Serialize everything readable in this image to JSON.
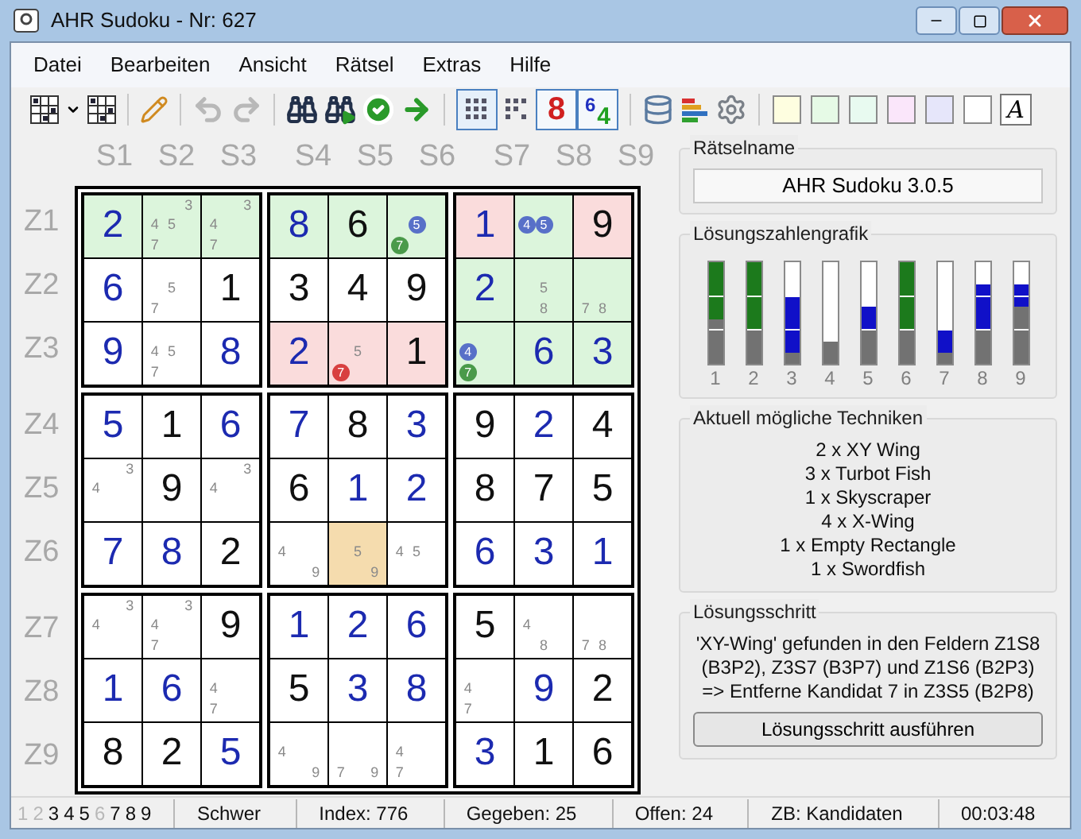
{
  "window": {
    "title": "AHR Sudoku - Nr: 627"
  },
  "menu": [
    "Datei",
    "Bearbeiten",
    "Ansicht",
    "Rätsel",
    "Extras",
    "Hilfe"
  ],
  "toolbar": {
    "undo": {
      "disabled": true
    },
    "redo": {
      "disabled": true
    },
    "all_candidates": {
      "selected": true
    },
    "value_mode": {
      "label": "8",
      "selected": true
    },
    "candidate_mode": {
      "labels": [
        "6",
        "4"
      ],
      "selected": true
    },
    "swatches": [
      {
        "color": "#fefee0"
      },
      {
        "color": "#e6fae6"
      },
      {
        "color": "#e8faf0"
      },
      {
        "color": "#fae6fa"
      },
      {
        "color": "#e6e6fa"
      },
      {
        "color": "#ffffff"
      }
    ],
    "font_button": "A"
  },
  "grid": {
    "columns": [
      "S1",
      "S2",
      "S3",
      "S4",
      "S5",
      "S6",
      "S7",
      "S8",
      "S9"
    ],
    "rows": [
      {
        "label": "Z1",
        "cells": [
          {
            "value": "2",
            "given": false,
            "color": "#dcf5dc"
          },
          {
            "candidates": [
              {
                "digit": "3"
              },
              {
                "digit": "4"
              },
              {
                "digit": "5"
              },
              {
                "digit": "7"
              }
            ],
            "color": "#dcf5dc"
          },
          {
            "candidates": [
              {
                "digit": "3"
              },
              {
                "digit": "4"
              },
              {
                "digit": "7"
              }
            ],
            "color": "#dcf5dc"
          },
          {
            "value": "8",
            "given": false,
            "color": "#dcf5dc"
          },
          {
            "value": "6",
            "given": true,
            "color": "#dcf5dc"
          },
          {
            "candidates": [
              {
                "digit": "5",
                "color": "#5870c8"
              },
              {
                "digit": "7",
                "color": "#4a9a4a"
              }
            ],
            "color": "#dcf5dc"
          },
          {
            "value": "1",
            "given": false,
            "color": "#fadcdc"
          },
          {
            "candidates": [
              {
                "digit": "4",
                "color": "#5870c8"
              },
              {
                "digit": "5",
                "color": "#5870c8"
              }
            ],
            "color": "#dcf5dc"
          },
          {
            "value": "9",
            "given": true,
            "color": "#fadcdc"
          }
        ]
      },
      {
        "label": "Z2",
        "cells": [
          {
            "value": "6",
            "given": false
          },
          {
            "candidates": [
              {
                "digit": "5"
              },
              {
                "digit": "7"
              }
            ]
          },
          {
            "value": "1",
            "given": true
          },
          {
            "value": "3",
            "given": true
          },
          {
            "value": "4",
            "given": true
          },
          {
            "value": "9",
            "given": true
          },
          {
            "value": "2",
            "given": false,
            "color": "#dcf5dc"
          },
          {
            "candidates": [
              {
                "digit": "5"
              },
              {
                "digit": "8"
              }
            ],
            "color": "#dcf5dc"
          },
          {
            "candidates": [
              {
                "digit": "7"
              },
              {
                "digit": "8"
              }
            ],
            "color": "#dcf5dc"
          }
        ]
      },
      {
        "label": "Z3",
        "cells": [
          {
            "value": "9",
            "given": false
          },
          {
            "candidates": [
              {
                "digit": "4"
              },
              {
                "digit": "5"
              },
              {
                "digit": "7"
              }
            ]
          },
          {
            "value": "8",
            "given": false
          },
          {
            "value": "2",
            "given": false,
            "color": "#fadcdc"
          },
          {
            "candidates": [
              {
                "digit": "5"
              },
              {
                "digit": "7",
                "color": "#d84040"
              }
            ],
            "color": "#fadcdc"
          },
          {
            "value": "1",
            "given": true,
            "color": "#fadcdc"
          },
          {
            "candidates": [
              {
                "digit": "4",
                "color": "#5870c8"
              },
              {
                "digit": "7",
                "color": "#4a9a4a"
              }
            ],
            "color": "#dcf5dc"
          },
          {
            "value": "6",
            "given": false,
            "color": "#dcf5dc"
          },
          {
            "value": "3",
            "given": false,
            "color": "#dcf5dc"
          }
        ]
      },
      {
        "label": "Z4",
        "cells": [
          {
            "value": "5",
            "given": false
          },
          {
            "value": "1",
            "given": true
          },
          {
            "value": "6",
            "given": false
          },
          {
            "value": "7",
            "given": false
          },
          {
            "value": "8",
            "given": true
          },
          {
            "value": "3",
            "given": false
          },
          {
            "value": "9",
            "given": true
          },
          {
            "value": "2",
            "given": false
          },
          {
            "value": "4",
            "given": true
          }
        ]
      },
      {
        "label": "Z5",
        "cells": [
          {
            "candidates": [
              {
                "digit": "3"
              },
              {
                "digit": "4"
              }
            ]
          },
          {
            "value": "9",
            "given": true
          },
          {
            "candidates": [
              {
                "digit": "3"
              },
              {
                "digit": "4"
              }
            ]
          },
          {
            "value": "6",
            "given": true
          },
          {
            "value": "1",
            "given": false
          },
          {
            "value": "2",
            "given": false
          },
          {
            "value": "8",
            "given": true
          },
          {
            "value": "7",
            "given": true
          },
          {
            "value": "5",
            "given": true
          }
        ]
      },
      {
        "label": "Z6",
        "cells": [
          {
            "value": "7",
            "given": false
          },
          {
            "value": "8",
            "given": false
          },
          {
            "value": "2",
            "given": true
          },
          {
            "candidates": [
              {
                "digit": "4"
              },
              {
                "digit": "9"
              }
            ]
          },
          {
            "candidates": [
              {
                "digit": "5"
              },
              {
                "digit": "9"
              }
            ],
            "color": "#f5dcae"
          },
          {
            "candidates": [
              {
                "digit": "4"
              },
              {
                "digit": "5"
              }
            ]
          },
          {
            "value": "6",
            "given": false
          },
          {
            "value": "3",
            "given": false
          },
          {
            "value": "1",
            "given": false
          }
        ]
      },
      {
        "label": "Z7",
        "cells": [
          {
            "candidates": [
              {
                "digit": "3"
              },
              {
                "digit": "4"
              }
            ]
          },
          {
            "candidates": [
              {
                "digit": "3"
              },
              {
                "digit": "4"
              },
              {
                "digit": "7"
              }
            ]
          },
          {
            "value": "9",
            "given": true
          },
          {
            "value": "1",
            "given": false
          },
          {
            "value": "2",
            "given": false
          },
          {
            "value": "6",
            "given": false
          },
          {
            "value": "5",
            "given": true
          },
          {
            "candidates": [
              {
                "digit": "4"
              },
              {
                "digit": "8"
              }
            ]
          },
          {
            "candidates": [
              {
                "digit": "7"
              },
              {
                "digit": "8"
              }
            ]
          }
        ]
      },
      {
        "label": "Z8",
        "cells": [
          {
            "value": "1",
            "given": false
          },
          {
            "value": "6",
            "given": false
          },
          {
            "candidates": [
              {
                "digit": "4"
              },
              {
                "digit": "7"
              }
            ]
          },
          {
            "value": "5",
            "given": true
          },
          {
            "value": "3",
            "given": false
          },
          {
            "value": "8",
            "given": false
          },
          {
            "candidates": [
              {
                "digit": "4"
              },
              {
                "digit": "7"
              }
            ]
          },
          {
            "value": "9",
            "given": false
          },
          {
            "value": "2",
            "given": true
          }
        ]
      },
      {
        "label": "Z9",
        "cells": [
          {
            "value": "8",
            "given": true
          },
          {
            "value": "2",
            "given": true
          },
          {
            "value": "5",
            "given": false
          },
          {
            "candidates": [
              {
                "digit": "4"
              },
              {
                "digit": "9"
              }
            ]
          },
          {
            "candidates": [
              {
                "digit": "7"
              },
              {
                "digit": "9"
              }
            ]
          },
          {
            "candidates": [
              {
                "digit": "4"
              },
              {
                "digit": "7"
              }
            ]
          },
          {
            "value": "3",
            "given": false
          },
          {
            "value": "1",
            "given": true
          },
          {
            "value": "6",
            "given": true
          }
        ]
      }
    ]
  },
  "puzzle_name": {
    "title": "Rätselname",
    "value": "AHR Sudoku 3.0.5"
  },
  "solution_chart": {
    "title": "Lösungszahlengrafik",
    "bars": [
      {
        "label": "1",
        "complete": true,
        "given": {
          "level": 0.444
        },
        "placed": {
          "level": 1
        }
      },
      {
        "label": "2",
        "complete": true,
        "given": {
          "level": 0.333
        },
        "placed": {
          "level": 1
        }
      },
      {
        "label": "3",
        "complete": false,
        "given": {
          "level": 0.111
        },
        "placed": {
          "level": 0.667
        }
      },
      {
        "label": "4",
        "given": {
          "level": 0.222
        }
      },
      {
        "label": "5",
        "complete": false,
        "given": {
          "level": 0.333
        },
        "placed": {
          "level": 0.556
        }
      },
      {
        "label": "6",
        "complete": true,
        "given": {
          "level": 0.333
        },
        "placed": {
          "level": 1
        }
      },
      {
        "label": "7",
        "complete": false,
        "given": {
          "level": 0.111
        },
        "placed": {
          "level": 0.333
        }
      },
      {
        "label": "8",
        "complete": false,
        "given": {
          "level": 0.333
        },
        "placed": {
          "level": 0.778
        }
      },
      {
        "label": "9",
        "complete": false,
        "given": {
          "level": 0.556
        },
        "placed": {
          "level": 0.778
        }
      }
    ]
  },
  "techniques": {
    "title": "Aktuell mögliche Techniken",
    "items": [
      "2 x XY Wing",
      "3 x Turbot Fish",
      "1 x Skyscraper",
      "4 x X-Wing",
      "1 x Empty Rectangle",
      "1 x Swordfish"
    ]
  },
  "solution_step": {
    "title": "Lösungsschritt",
    "lines": [
      "'XY-Wing' gefunden in den Feldern Z1S8",
      "(B3P2), Z3S7 (B3P7) und Z1S6 (B2P3)",
      "=> Entferne Kandidat 7 in Z3S5 (B2P8)"
    ],
    "button": "Lösungsschritt ausführen"
  },
  "status_bar": {
    "digits": [
      {
        "label": "1",
        "done": true
      },
      {
        "label": "2",
        "done": true
      },
      {
        "label": "3",
        "done": false
      },
      {
        "label": "4",
        "done": false
      },
      {
        "label": "5",
        "done": false
      },
      {
        "label": "6",
        "done": true
      },
      {
        "label": "7",
        "done": false
      },
      {
        "label": "8",
        "done": false
      },
      {
        "label": "9",
        "done": false
      }
    ],
    "fields": [
      "Schwer",
      "Index: 776",
      "Gegeben: 25",
      "Offen: 24",
      "ZB: Kandidaten",
      "00:03:48"
    ]
  }
}
